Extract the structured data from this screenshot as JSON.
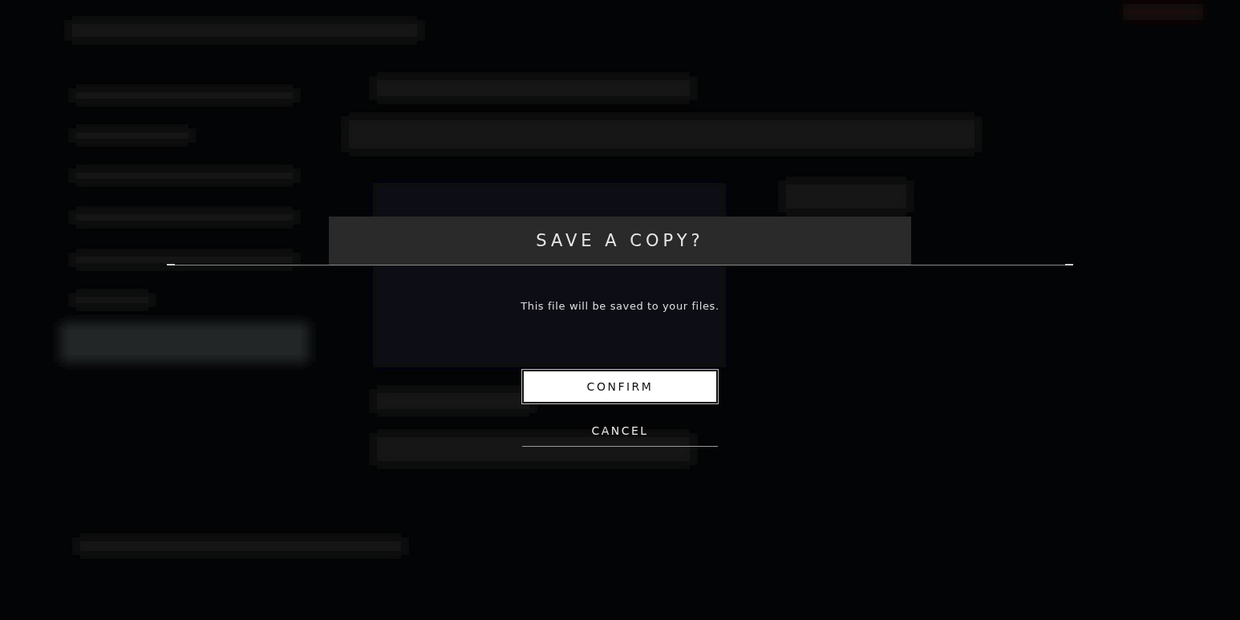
{
  "dialog": {
    "title": "SAVE A COPY?",
    "message": "This file will be saved to your files.",
    "buttons": [
      {
        "label": "CONFIRM",
        "selected": true
      },
      {
        "label": "CANCEL",
        "selected": false
      }
    ]
  }
}
